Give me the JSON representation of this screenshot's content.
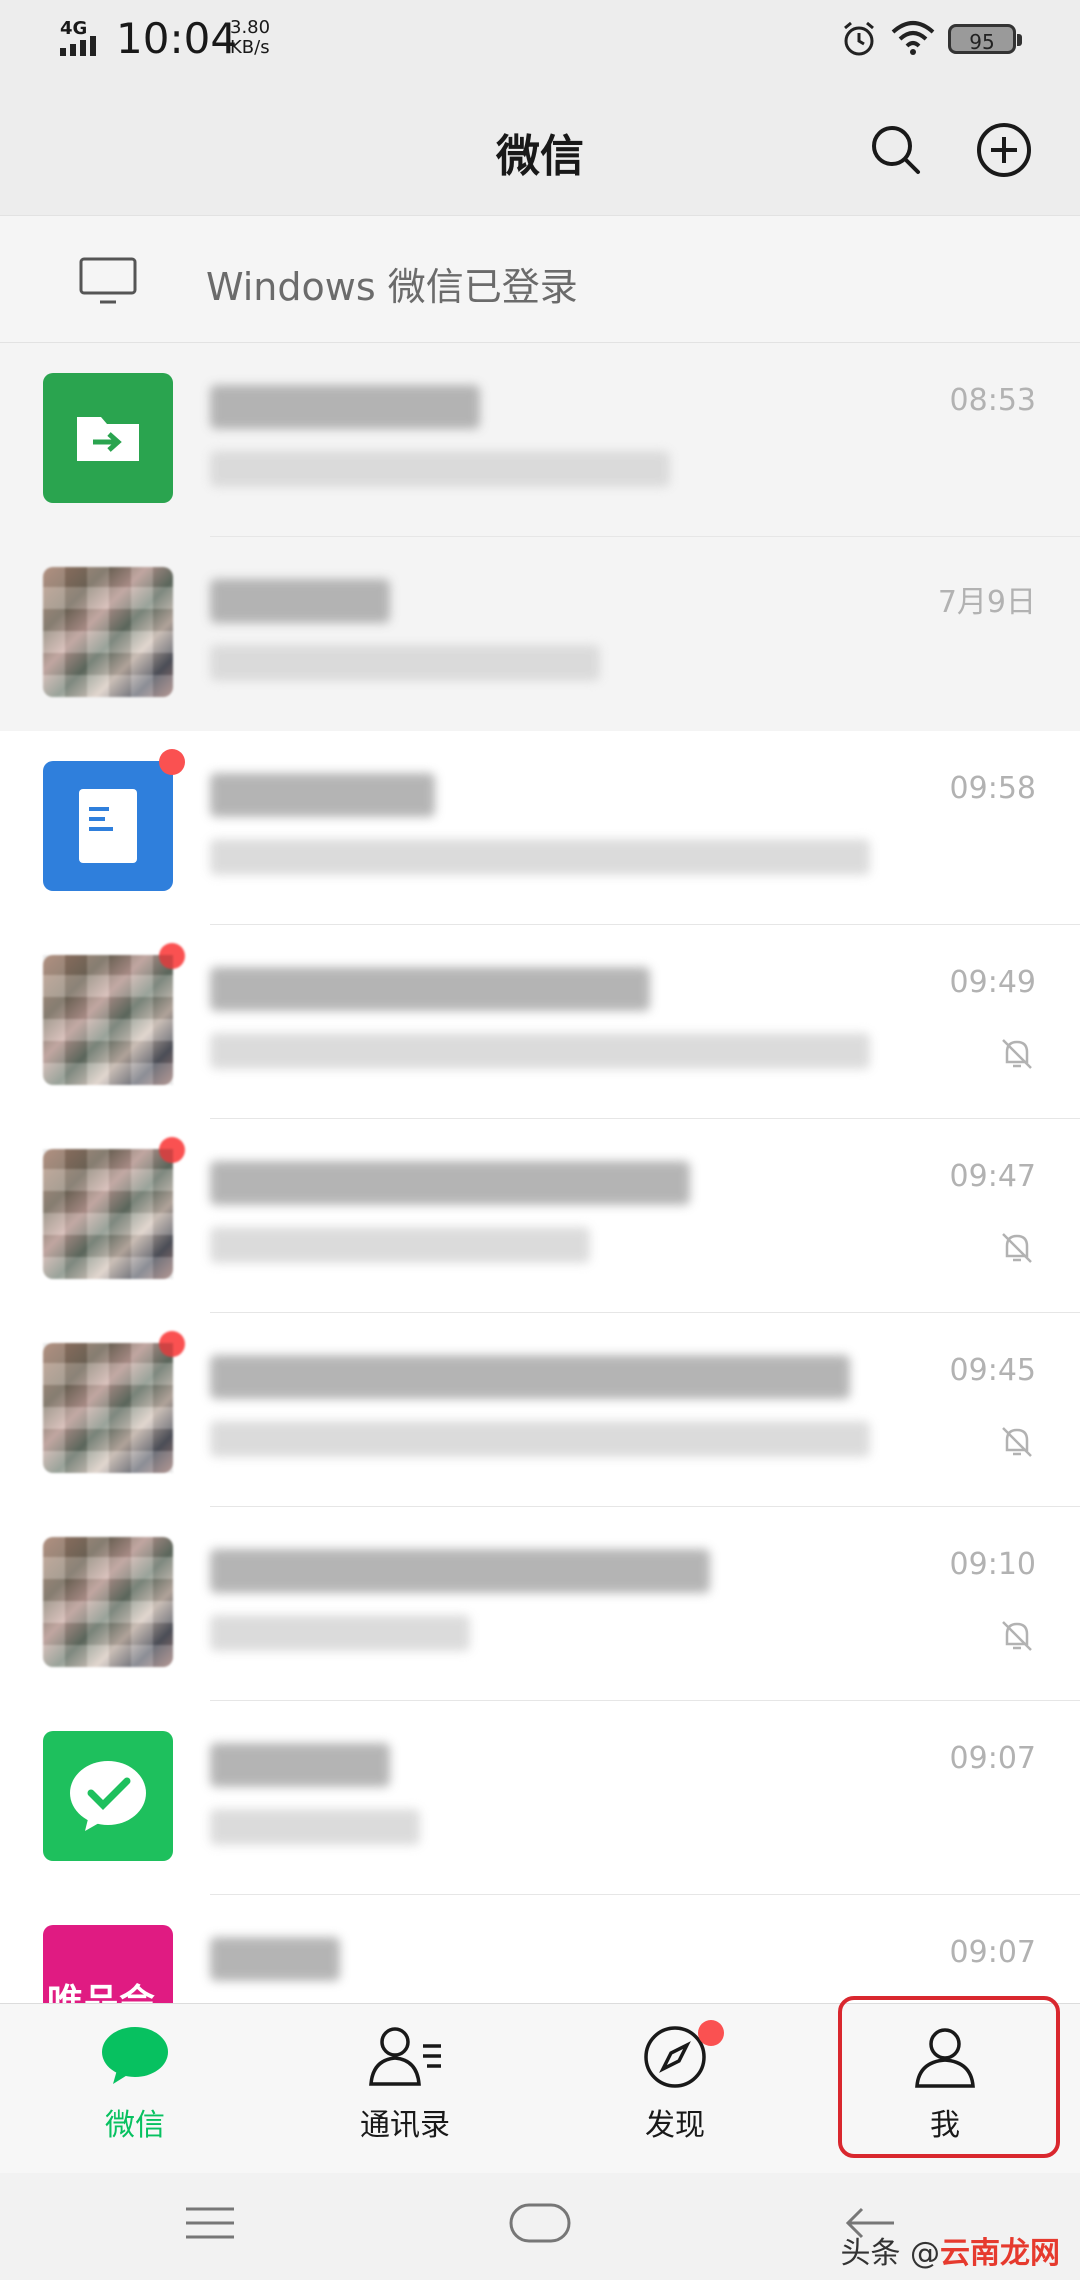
{
  "status_bar": {
    "network": "4G",
    "time": "10:04",
    "speed_value": "3.80",
    "speed_unit": "KB/s",
    "battery": "95",
    "icons": [
      "alarm-icon",
      "wifi-icon",
      "battery-icon"
    ]
  },
  "header": {
    "title": "微信",
    "search_icon": "search-icon",
    "add_icon": "plus-circle-icon"
  },
  "login_banner": {
    "text": "Windows 微信已登录",
    "icon": "monitor-icon"
  },
  "chats": [
    {
      "time": "08:53",
      "avatar": "file-transfer-icon",
      "pinned": true,
      "unread_dot": false,
      "muted": false
    },
    {
      "time": "7月9日",
      "avatar": "group-avatar",
      "pinned": true,
      "unread_dot": false,
      "muted": false
    },
    {
      "time": "09:58",
      "avatar": "document-icon",
      "pinned": false,
      "unread_dot": true,
      "muted": false
    },
    {
      "time": "09:49",
      "avatar": "group-avatar",
      "pinned": false,
      "unread_dot": true,
      "muted": true
    },
    {
      "time": "09:47",
      "avatar": "group-avatar",
      "pinned": false,
      "unread_dot": true,
      "muted": true
    },
    {
      "time": "09:45",
      "avatar": "group-avatar",
      "pinned": false,
      "unread_dot": true,
      "muted": true
    },
    {
      "time": "09:10",
      "avatar": "group-avatar",
      "pinned": false,
      "unread_dot": false,
      "muted": true
    },
    {
      "time": "09:07",
      "avatar": "wechat-pay-icon",
      "pinned": false,
      "unread_dot": false,
      "muted": false
    },
    {
      "time": "09:07",
      "avatar": "vip-logo",
      "avatar_text": "唯品会",
      "pinned": false,
      "unread_dot": false,
      "muted": false
    }
  ],
  "tabbar": {
    "tabs": [
      {
        "label": "微信",
        "icon": "chat-bubble-icon",
        "active": true
      },
      {
        "label": "通讯录",
        "icon": "contacts-icon",
        "active": false
      },
      {
        "label": "发现",
        "icon": "compass-icon",
        "active": false,
        "dot": true
      },
      {
        "label": "我",
        "icon": "person-icon",
        "active": false,
        "highlighted": true
      }
    ]
  },
  "watermark": {
    "prefix": "头条 @",
    "brand": "云南龙网"
  },
  "colors": {
    "accent": "#07c160",
    "badge": "#fa5151",
    "highlight_border": "#d9272e"
  }
}
